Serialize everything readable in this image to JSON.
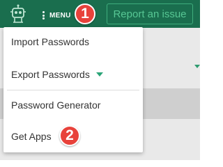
{
  "header": {
    "menu_label": "MENU",
    "report_button": "Report an issue",
    "logo_icon": "robot-logo-icon",
    "menu_icon": "kebab-menu-icon"
  },
  "callouts": {
    "first": "1",
    "second": "2"
  },
  "dropdown": {
    "items": [
      {
        "label": "Import Passwords"
      },
      {
        "label": "Export Passwords",
        "has_submenu": true,
        "submenu_icon": "caret-down-icon"
      },
      {
        "label": "Password Generator"
      },
      {
        "label": "Get Apps"
      }
    ]
  },
  "colors": {
    "header_bg": "#1a6e4e",
    "accent": "#2aa477",
    "callout": "#e8423b"
  }
}
